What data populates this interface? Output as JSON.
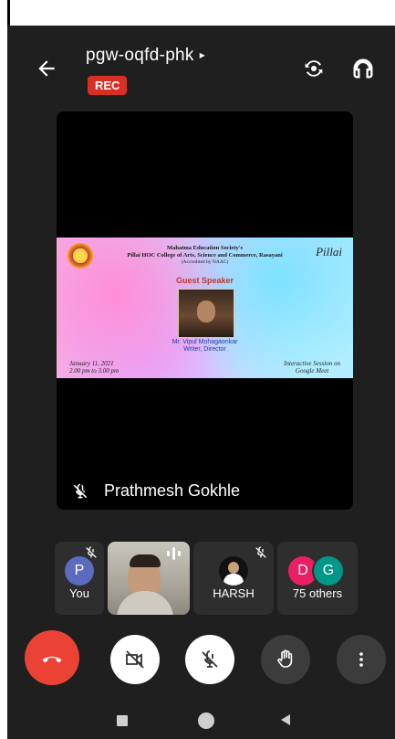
{
  "meeting": {
    "code": "pgw-oqfd-phk",
    "code_caret": "▸",
    "recording_badge": "REC"
  },
  "stage": {
    "speaker_name": "Prathmesh Gokhle",
    "poster": {
      "org_line1": "Mahatma Education Society's",
      "org_line2": "Pillai HOC College of Arts, Science and Commerce, Rasayani",
      "org_line3": "(Accredited by NAAC)",
      "signature": "Pillai",
      "heading": "Guest Speaker",
      "speaker_line1": "Mr. Vipul Mohagaonkar",
      "speaker_line2": "Writer, Director",
      "date_line1": "January 11, 2021",
      "date_line2": "2.00 pm to 3.00 pm",
      "session_line1": "Interactive Session on",
      "session_line2": "Google Meet"
    }
  },
  "participants": [
    {
      "label": "You",
      "avatar_letter": "P",
      "avatar_color": "#5c6bc0",
      "muted": true
    },
    {
      "label": "",
      "video": true,
      "speaking": true
    },
    {
      "label": "HARSH",
      "muted": true
    },
    {
      "label": "75 others",
      "avatar_letters": [
        "D",
        "G"
      ],
      "avatar_colors": [
        "#e91e63",
        "#009688"
      ]
    }
  ],
  "colors": {
    "background": "#1f1f1f",
    "tile": "#2e2e2e",
    "end_call": "#ea4335",
    "rec": "#d93025",
    "control_light": "#ffffff",
    "control_dark": "#3c3c3c"
  },
  "icons": [
    "back-arrow-icon",
    "switch-camera-icon",
    "headphones-icon",
    "mic-off-icon",
    "end-call-icon",
    "camera-off-icon",
    "raise-hand-icon",
    "more-options-icon",
    "nav-recents-icon",
    "nav-home-icon",
    "nav-back-icon"
  ]
}
